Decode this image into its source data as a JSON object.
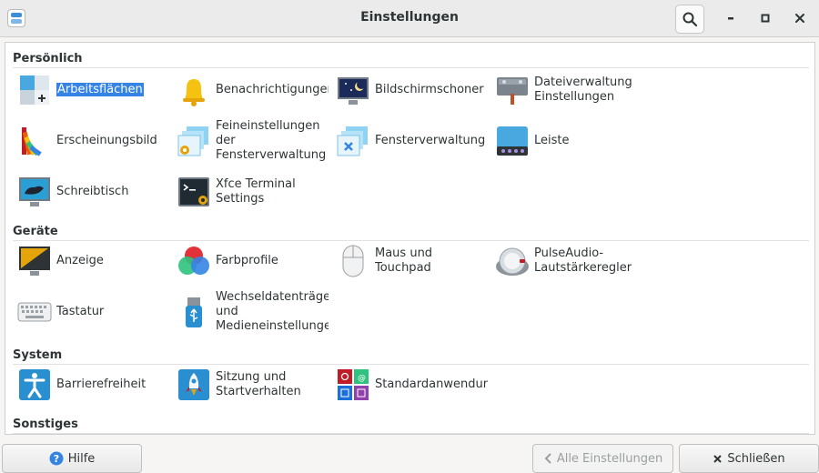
{
  "window": {
    "title": "Einstellungen"
  },
  "sections": [
    {
      "title": "Persönlich",
      "items": [
        {
          "label": "Arbeitsflächen",
          "icon": "workspaces-icon"
        },
        {
          "label": "Benachrichtigungen",
          "icon": "bell-icon"
        },
        {
          "label": "Bildschirmschoner",
          "icon": "screensaver-icon"
        },
        {
          "label": "Dateiverwaltung Einstellungen",
          "icon": "file-manager-icon"
        },
        {
          "label": "Erscheinungsbild",
          "icon": "appearance-icon"
        },
        {
          "label": "Feineinstellungen der Fensterverwaltung",
          "icon": "window-manager-tweaks-icon"
        },
        {
          "label": "Fensterverwaltung",
          "icon": "window-manager-icon"
        },
        {
          "label": "Leiste",
          "icon": "panel-icon"
        },
        {
          "label": "Schreibtisch",
          "icon": "desktop-icon"
        },
        {
          "label": "Xfce Terminal Settings",
          "icon": "terminal-icon"
        }
      ]
    },
    {
      "title": "Geräte",
      "items": [
        {
          "label": "Anzeige",
          "icon": "display-icon"
        },
        {
          "label": "Farbprofile",
          "icon": "color-profiles-icon"
        },
        {
          "label": "Maus und Touchpad",
          "icon": "mouse-icon"
        },
        {
          "label": "PulseAudio-Lautstärkeregler",
          "icon": "volume-knob-icon"
        },
        {
          "label": "Tastatur",
          "icon": "keyboard-icon"
        },
        {
          "label": "Wechseldatenträger und Medieneinstellungen",
          "icon": "usb-drive-icon"
        }
      ]
    },
    {
      "title": "System",
      "items": [
        {
          "label": "Barrierefreiheit",
          "icon": "accessibility-icon"
        },
        {
          "label": "Sitzung und Startverhalten",
          "icon": "rocket-icon"
        },
        {
          "label": "Standardanwendungen",
          "icon": "default-apps-icon"
        }
      ]
    },
    {
      "title": "Sonstiges",
      "items": []
    }
  ],
  "buttons": {
    "help": "Hilfe",
    "all_settings": "Alle Einstellungen",
    "close": "Schließen"
  },
  "colors": {
    "accent": "#3584e4",
    "background": "#f6f5f4"
  }
}
